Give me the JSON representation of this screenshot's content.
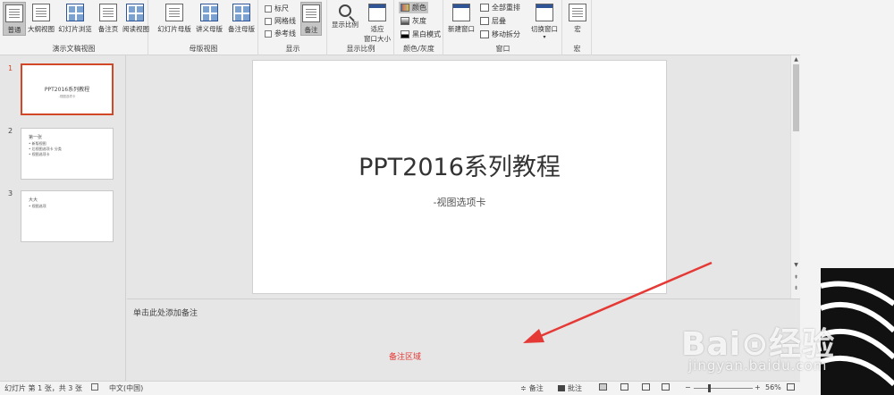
{
  "ribbon": {
    "presentation_views": {
      "label": "演示文稿视图",
      "buttons": [
        "普通",
        "大纲视图",
        "幻灯片浏览",
        "备注页",
        "阅读视图"
      ]
    },
    "master_views": {
      "label": "母版视图",
      "buttons": [
        "幻灯片母版",
        "讲义母版",
        "备注母版"
      ]
    },
    "show": {
      "label": "显示",
      "checkboxes": [
        "标尺",
        "网格线",
        "参考线"
      ],
      "notes_button": "备注"
    },
    "zoom": {
      "label": "显示比例",
      "zoom_button": "显示比例",
      "fit_line1": "适应",
      "fit_line2": "窗口大小"
    },
    "color": {
      "label": "颜色/灰度",
      "items": [
        "颜色",
        "灰度",
        "黑白模式"
      ]
    },
    "window": {
      "label": "窗口",
      "new_window": "新建窗口",
      "arrange_all": "全部重排",
      "cascade": "层叠",
      "move_split": "移动拆分",
      "switch_windows": "切换窗口"
    },
    "macros": {
      "label": "宏",
      "button": "宏"
    }
  },
  "thumbnails": [
    {
      "number": "1",
      "title": "PPT2016系列教程",
      "subtitle": "-视图选项卡"
    },
    {
      "number": "2",
      "lines": [
        "第一张",
        "• 新版视图",
        "• 后视图选项卡 分类",
        "• 视图选项卡"
      ]
    },
    {
      "number": "3",
      "lines": [
        "大大",
        "• 视图选项"
      ]
    }
  ],
  "slide": {
    "title": "PPT2016系列教程",
    "subtitle": "-视图选项卡"
  },
  "notes": {
    "placeholder": "单击此处添加备注",
    "annotation": "备注区域"
  },
  "status": {
    "slide_info": "幻灯片 第 1 张，共 3 张",
    "language": "中文(中国)",
    "notes_btn": "备注",
    "comments_btn": "批注",
    "zoom_minus": "−",
    "zoom_plus": "+",
    "zoom": "56%"
  },
  "watermark": {
    "logo": "Bai⊙经验",
    "url": "jingyan.baidu.com"
  },
  "colors": {
    "accent": "#d24726",
    "arrow": "#e53935",
    "ribbon_bg": "#f3f3f3",
    "workspace_bg": "#e6e6e6"
  }
}
